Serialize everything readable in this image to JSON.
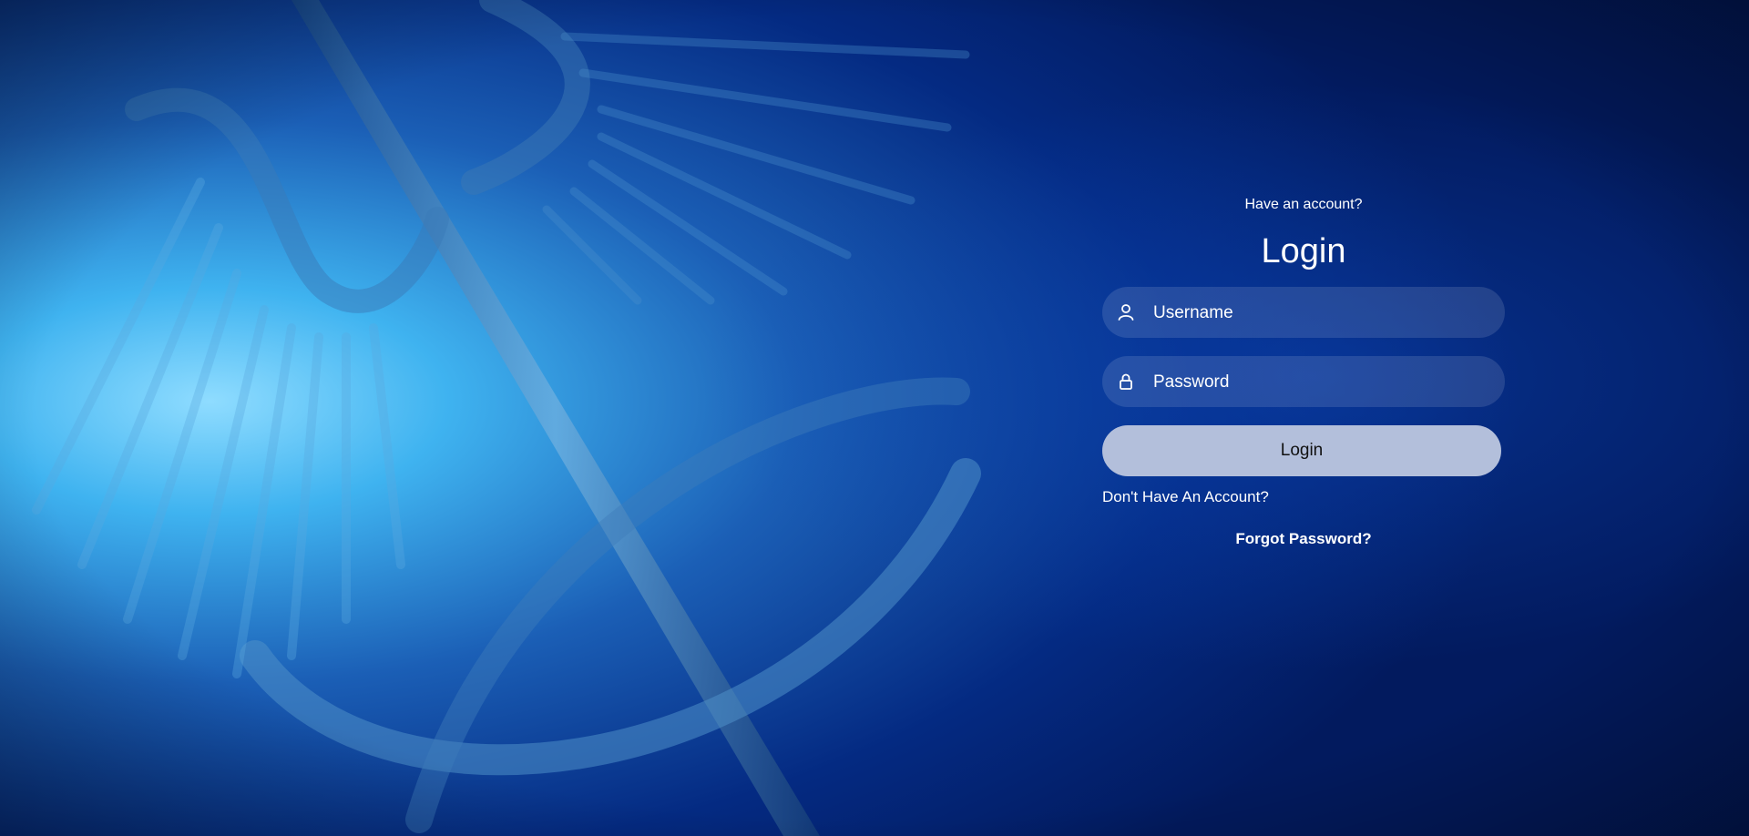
{
  "login": {
    "subtitle": "Have an account?",
    "title": "Login",
    "username_placeholder": "Username",
    "password_placeholder": "Password",
    "login_button": "Login",
    "signup_link": "Don't Have An Account?",
    "forgot_link": "Forgot Password?"
  },
  "icons": {
    "username": "user-icon",
    "password": "lock-icon",
    "background": "caduceus-image"
  },
  "colors": {
    "background_dark": "#021a5e",
    "background_light": "#62c8ff",
    "button": "#b3bfdb",
    "text": "#ffffff"
  }
}
